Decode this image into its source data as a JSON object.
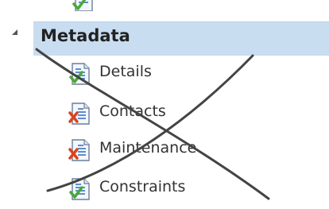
{
  "tree": {
    "partial_item": {
      "icon": "document-check-icon",
      "label_fragment": ""
    },
    "group": {
      "label": "Metadata",
      "expanded": true,
      "items": [
        {
          "label": "Details",
          "status": "valid",
          "icon": "document-check-icon"
        },
        {
          "label": "Contacts",
          "status": "invalid",
          "icon": "document-error-icon"
        },
        {
          "label": "Maintenance",
          "status": "invalid",
          "icon": "document-error-icon"
        },
        {
          "label": "Constraints",
          "status": "valid",
          "icon": "document-check-icon"
        }
      ]
    }
  },
  "colors": {
    "selected_row_bg": "#c9ddf1",
    "valid_check": "#4aa83a",
    "invalid_x": "#d9441f",
    "crossed_out_stroke": "#444444"
  }
}
